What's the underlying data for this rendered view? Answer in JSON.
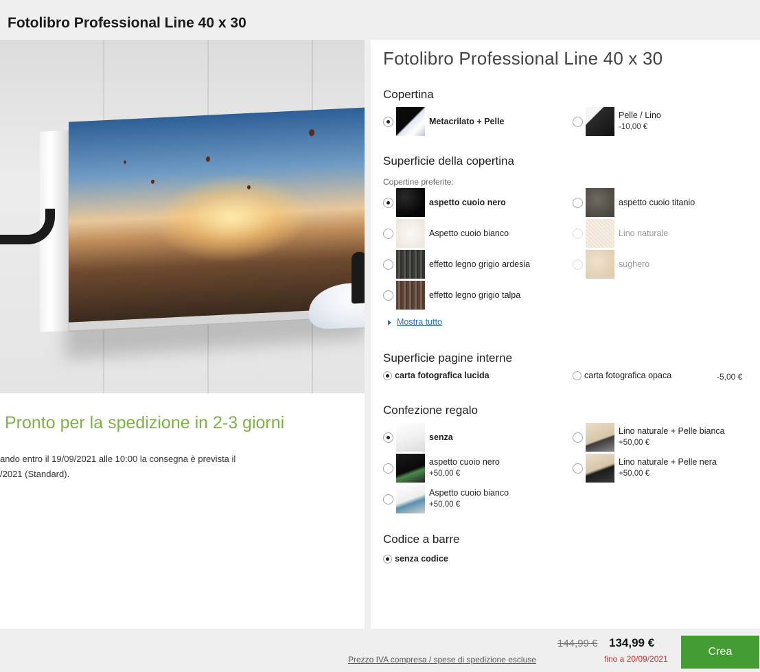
{
  "page": {
    "title": "Fotolibro Professional Line 40 x 30"
  },
  "shipping": {
    "heading": "Pronto per la spedizione in 2-3 giorni",
    "line1": "ando entro il 19/09/2021 alle 10:00 la consegna è prevista il",
    "line2": "/2021 (Standard)."
  },
  "product": {
    "title": "Fotolibro Professional Line 40 x 30",
    "copertina": {
      "title": "Copertina",
      "options": [
        {
          "label": "Metacrilato + Pelle",
          "price": "",
          "selected": true
        },
        {
          "label": "Pelle / Lino",
          "price": "-10,00 €",
          "selected": false
        }
      ]
    },
    "superficie": {
      "title": "Superficie della copertina",
      "note": "Copertine preferite:",
      "options": [
        {
          "label": "aspetto cuoio nero",
          "selected": true
        },
        {
          "label": "aspetto cuoio titanio",
          "selected": false
        },
        {
          "label": "Aspetto cuoio bianco",
          "selected": false
        },
        {
          "label": "Lino naturale",
          "selected": false,
          "disabled": true
        },
        {
          "label": "effetto legno grigio ardesia",
          "selected": false
        },
        {
          "label": "sughero",
          "selected": false,
          "disabled": true
        },
        {
          "label": "effetto legno grigio talpa",
          "selected": false
        }
      ],
      "show_all": "Mostra tutto"
    },
    "pagine": {
      "title": "Superficie pagine interne",
      "options": [
        {
          "label": "carta fotografica lucida",
          "price": "",
          "selected": true
        },
        {
          "label": "carta fotografica opaca",
          "price": "-5,00 €",
          "selected": false
        }
      ]
    },
    "regalo": {
      "title": "Confezione regalo",
      "options": [
        {
          "label": "senza",
          "price": "",
          "selected": true
        },
        {
          "label": "Lino naturale + Pelle bianca",
          "price": "+50,00 €",
          "selected": false
        },
        {
          "label": "aspetto cuoio nero",
          "price": "+50,00 €",
          "selected": false
        },
        {
          "label": "Lino naturale + Pelle nera",
          "price": "+50,00 €",
          "selected": false
        },
        {
          "label": "Aspetto cuoio bianco",
          "price": "+50,00 €",
          "selected": false
        }
      ]
    },
    "barcode": {
      "title": "Codice a barre",
      "options": [
        {
          "label": "senza codice",
          "selected": true
        }
      ]
    }
  },
  "footer": {
    "tax_note": "Prezzo IVA compresa / spese di spedizione escluse",
    "price_old": "144,99 €",
    "price_new": "134,99 €",
    "price_until": "fino a 20/09/2021",
    "button": "Crea"
  },
  "colors": {
    "accent_green": "#449d32",
    "heading_green": "#7cb342",
    "link_blue": "#2f6db5",
    "sale_red": "#d32f2f"
  }
}
